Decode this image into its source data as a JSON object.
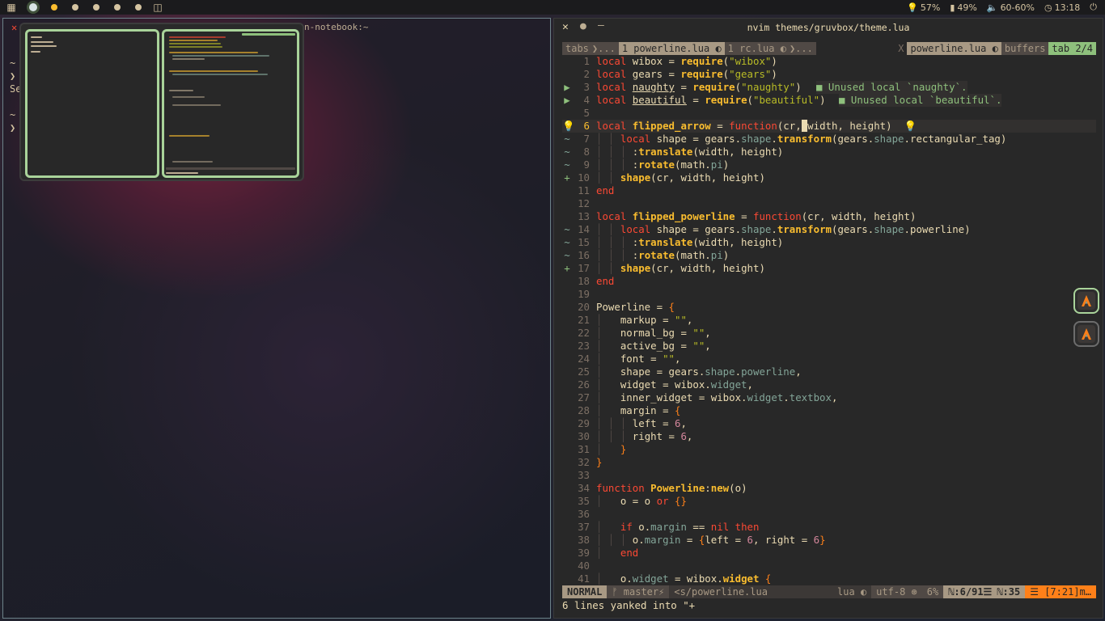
{
  "topbar": {
    "launcher_icon": "grid-icon",
    "workspaces": [
      {
        "name": "workspace-1",
        "state": "active"
      },
      {
        "name": "workspace-2",
        "state": "occupied"
      },
      {
        "name": "workspace-3",
        "state": "empty"
      },
      {
        "name": "workspace-4",
        "state": "empty"
      },
      {
        "name": "workspace-5",
        "state": "empty"
      },
      {
        "name": "workspace-6",
        "state": "empty"
      }
    ],
    "layout_icon": "tile-layout-icon",
    "brightness": "57%",
    "battery": "49%",
    "volume": "60-60%",
    "clock": "13:18",
    "power_icon": "power-icon"
  },
  "left_terminal": {
    "title": "n-notebook:~",
    "close_glyph": "✕",
    "lines": [
      "~",
      "❯",
      "Se",
      "~",
      "❯"
    ]
  },
  "right_window": {
    "title": "nvim themes/gruvbox/theme.lua",
    "close_glyph": "✕",
    "max_glyph": "●",
    "min_glyph": "—"
  },
  "tabline": {
    "tabs_label": "tabs",
    "more_left": "...",
    "tab1": "1 powerline.lua",
    "tab2": "1 rc.lua",
    "more_right": "...",
    "close_x": "X",
    "current_buffer": "powerline.lua",
    "buffers_label": "buffers",
    "tab_count": "tab 2/4"
  },
  "code": [
    {
      "n": "1",
      "sign": "",
      "html": "<span class='k'>local</span> wibox = <span class='f'>require</span>(<span class='s'>\"wibox\"</span>)"
    },
    {
      "n": "2",
      "sign": "",
      "html": "<span class='k'>local</span> gears = <span class='f'>require</span>(<span class='s'>\"gears\"</span>)"
    },
    {
      "n": "3",
      "sign": "▶",
      "html": "<span class='k'>local</span> <span class='u'>naughty</span> = <span class='f'>require</span>(<span class='s'>\"naughty\"</span>)",
      "diag": "■ Unused local `naughty`.",
      "diag_col": 272
    },
    {
      "n": "4",
      "sign": "▶",
      "html": "<span class='k'>local</span> <span class='u'>beautiful</span> = <span class='f'>require</span>(<span class='s'>\"beautiful\"</span>)",
      "diag": "■ Unused local `beautiful`.",
      "diag_col": 300
    },
    {
      "n": "5",
      "sign": "",
      "html": ""
    },
    {
      "n": "6",
      "sign": "💡",
      "cur": true,
      "html": "<span class='k'>local</span> <span class='f'>flipped_arrow</span> = <span class='k'>function</span>(cr,<span style='background:#ebdbb2;color:#282828'> </span>width, height)  <span style='color:#8ec07c'>💡</span>"
    },
    {
      "n": "7",
      "sign": "~",
      "html": "<span class='g'>│ │</span> <span class='k'>local</span> shape = gears.<span class='fld'>shape</span>.<span class='f'>transform</span>(gears.<span class='fld'>shape</span>.rectangular_tag)"
    },
    {
      "n": "8",
      "sign": "~",
      "html": "<span class='g'>│ │ │</span> :<span class='f'>translate</span>(width, height)"
    },
    {
      "n": "9",
      "sign": "~",
      "html": "<span class='g'>│ │ │</span> :<span class='f'>rotate</span>(math.<span class='fld'>pi</span>)"
    },
    {
      "n": "10",
      "sign": "+",
      "html": "<span class='g'>│ │</span> <span class='f'>shape</span>(cr, width, height)"
    },
    {
      "n": "11",
      "sign": "",
      "html": "<span class='k'>end</span>"
    },
    {
      "n": "12",
      "sign": "",
      "html": ""
    },
    {
      "n": "13",
      "sign": "",
      "html": "<span class='k'>local</span> <span class='f'>flipped_powerline</span> = <span class='k'>function</span>(cr, width, height)"
    },
    {
      "n": "14",
      "sign": "~",
      "html": "<span class='g'>│ │</span> <span class='k'>local</span> shape = gears.<span class='fld'>shape</span>.<span class='f'>transform</span>(gears.<span class='fld'>shape</span>.powerline)"
    },
    {
      "n": "15",
      "sign": "~",
      "html": "<span class='g'>│ │ │</span> :<span class='f'>translate</span>(width, height)"
    },
    {
      "n": "16",
      "sign": "~",
      "html": "<span class='g'>│ │ │</span> :<span class='f'>rotate</span>(math.<span class='fld'>pi</span>)"
    },
    {
      "n": "17",
      "sign": "+",
      "html": "<span class='g'>│ │</span> <span class='f'>shape</span>(cr, width, height)"
    },
    {
      "n": "18",
      "sign": "",
      "html": "<span class='k'>end</span>"
    },
    {
      "n": "19",
      "sign": "",
      "html": ""
    },
    {
      "n": "20",
      "sign": "",
      "html": "Powerline = <span class='p'>{</span>"
    },
    {
      "n": "21",
      "sign": "",
      "html": "<span class='g'>│</span>   markup = <span class='s'>\"\"</span>,"
    },
    {
      "n": "22",
      "sign": "",
      "html": "<span class='g'>│</span>   normal_bg = <span class='s'>\"\"</span>,"
    },
    {
      "n": "23",
      "sign": "",
      "html": "<span class='g'>│</span>   active_bg = <span class='s'>\"\"</span>,"
    },
    {
      "n": "24",
      "sign": "",
      "html": "<span class='g'>│</span>   font = <span class='s'>\"\"</span>,"
    },
    {
      "n": "25",
      "sign": "",
      "html": "<span class='g'>│</span>   shape = gears.<span class='fld'>shape</span>.<span class='fld'>powerline</span>,"
    },
    {
      "n": "26",
      "sign": "",
      "html": "<span class='g'>│</span>   widget = wibox.<span class='fld'>widget</span>,"
    },
    {
      "n": "27",
      "sign": "",
      "html": "<span class='g'>│</span>   inner_widget = wibox.<span class='fld'>widget</span>.<span class='fld'>textbox</span>,"
    },
    {
      "n": "28",
      "sign": "",
      "html": "<span class='g'>│</span>   margin = <span class='p'>{</span>"
    },
    {
      "n": "29",
      "sign": "",
      "html": "<span class='g'>│ │ │</span> left = <span class='n'>6</span>,"
    },
    {
      "n": "30",
      "sign": "",
      "html": "<span class='g'>│ │ │</span> right = <span class='n'>6</span>,"
    },
    {
      "n": "31",
      "sign": "",
      "html": "<span class='g'>│</span>   <span class='p'>}</span>"
    },
    {
      "n": "32",
      "sign": "",
      "html": "<span class='p'>}</span>"
    },
    {
      "n": "33",
      "sign": "",
      "html": ""
    },
    {
      "n": "34",
      "sign": "",
      "html": "<span class='k'>function</span> <span class='f'>Powerline</span>:<span class='f'>new</span>(o)"
    },
    {
      "n": "35",
      "sign": "",
      "html": "<span class='g'>│</span>   o = o <span class='k'>or</span> <span class='p'>{}</span>"
    },
    {
      "n": "36",
      "sign": "",
      "html": ""
    },
    {
      "n": "37",
      "sign": "",
      "html": "<span class='g'>│</span>   <span class='k'>if</span> o.<span class='fld'>margin</span> == <span class='k'>nil</span> <span class='k'>then</span>"
    },
    {
      "n": "38",
      "sign": "",
      "html": "<span class='g'>│ │ │</span> o.<span class='fld'>margin</span> = <span class='p'>{</span>left = <span class='n'>6</span>, right = <span class='n'>6</span><span class='p'>}</span>"
    },
    {
      "n": "39",
      "sign": "",
      "html": "<span class='g'>│</span>   <span class='k'>end</span>"
    },
    {
      "n": "40",
      "sign": "",
      "html": ""
    },
    {
      "n": "41",
      "sign": "",
      "html": "<span class='g'>│</span>   o.<span class='fld'>widget</span> = wibox.<span class='f'>widget</span> <span class='p'>{</span>"
    }
  ],
  "statusline": {
    "mode": "NORMAL",
    "branch": "ᚠ master⚡",
    "file": "<s/powerline.lua",
    "filetype": "lua ◐",
    "encoding": "utf-8 ⊛",
    "percent": "6%",
    "position": "ℕ:6/91☰",
    "column": "ℕ:35",
    "warning": "☰ [7:21]m…"
  },
  "cmdline": "6 lines yanked into \"+",
  "floating_icons": [
    "alacritty-icon",
    "alacritty-icon"
  ]
}
